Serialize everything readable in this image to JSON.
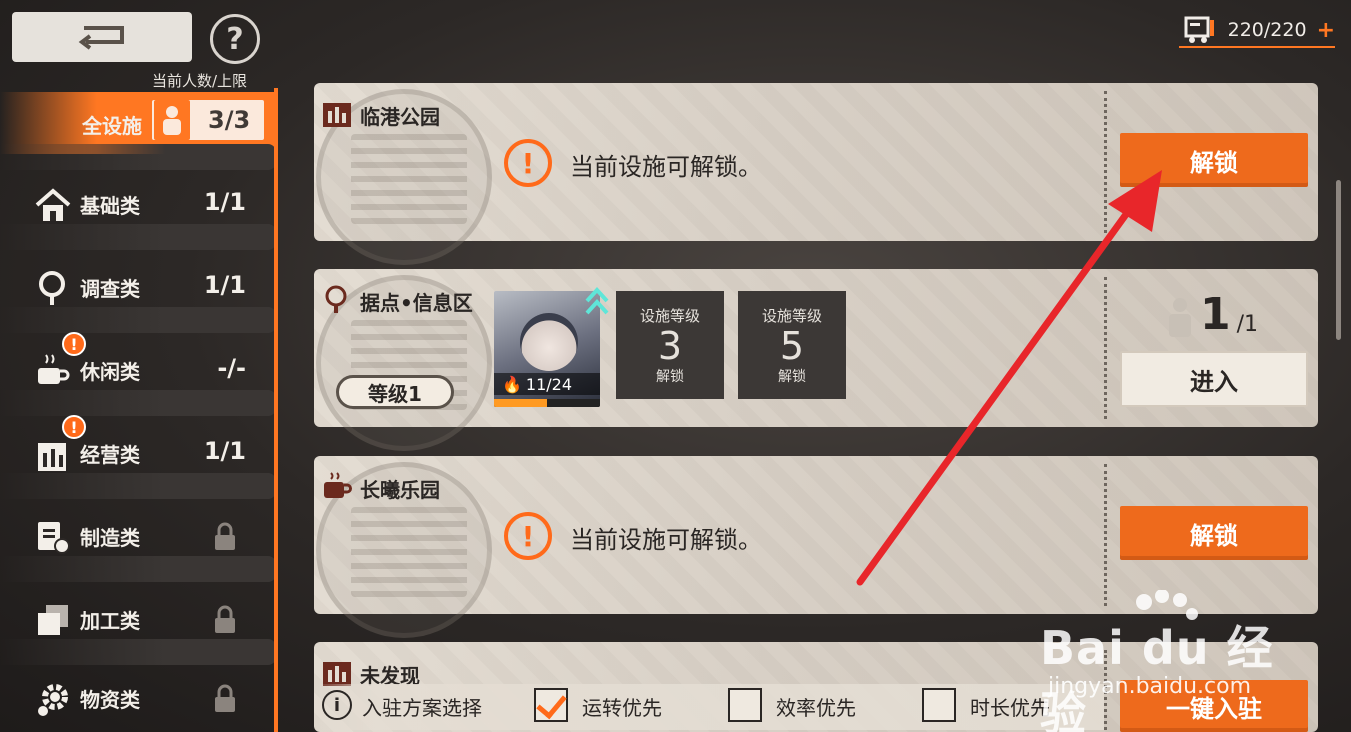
{
  "header": {
    "capacity_caption": "当前人数/上限",
    "stamina": "220/220",
    "stamina_plus": "+"
  },
  "sidebar": {
    "items": [
      {
        "label": "全设施",
        "count": "3/3",
        "active": true
      },
      {
        "label": "基础类",
        "count": "1/1"
      },
      {
        "label": "调查类",
        "count": "1/1"
      },
      {
        "label": "休闲类",
        "count": "-/-",
        "badge": "!"
      },
      {
        "label": "经营类",
        "count": "1/1",
        "badge": "!"
      },
      {
        "label": "制造类",
        "locked": true
      },
      {
        "label": "加工类",
        "locked": true
      },
      {
        "label": "物资类",
        "locked": true
      }
    ]
  },
  "facilities": [
    {
      "name": "临港公园",
      "message": "当前设施可解锁。",
      "button": "解锁"
    },
    {
      "name": "据点•信息区",
      "level": "等级1",
      "operator_stat": "11/24",
      "operator_progress": 0.5,
      "slots": [
        {
          "caption": "设施等级",
          "level": "3",
          "status": "解锁"
        },
        {
          "caption": "设施等级",
          "level": "5",
          "status": "解锁"
        }
      ],
      "occupancy_num": "1",
      "occupancy_den": "/1",
      "button": "进入"
    },
    {
      "name": "长曦乐园",
      "message": "当前设施可解锁。",
      "button": "解锁"
    },
    {
      "name": "未发现",
      "button": "一键入驻"
    }
  ],
  "bottom_bar": {
    "plan_label": "入驻方案选择",
    "options": [
      {
        "label": "运转优先",
        "checked": true
      },
      {
        "label": "效率优先",
        "checked": false
      },
      {
        "label": "时长优先",
        "checked": false
      }
    ]
  },
  "watermark": {
    "main": "Bai du 经验",
    "sub": "jingyan.baidu.com"
  },
  "colors": {
    "accent": "#ff7722",
    "button_orange": "#ee6a1c",
    "annotation_arrow": "#e8262a"
  }
}
